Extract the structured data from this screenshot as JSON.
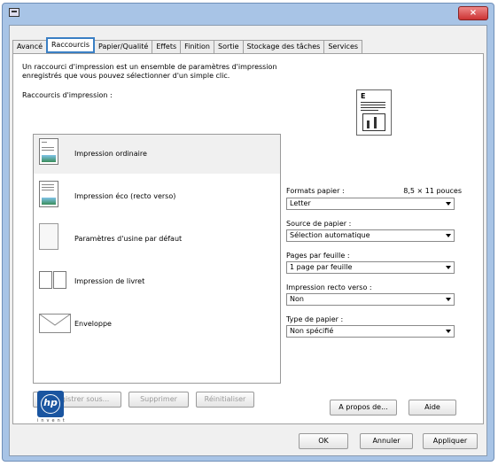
{
  "tabs": [
    "Avancé",
    "Raccourcis",
    "Papier/Qualité",
    "Effets",
    "Finition",
    "Sortie",
    "Stockage des tâches",
    "Services"
  ],
  "active_tab": "Raccourcis",
  "intro_text": "Un raccourci d'impression est un ensemble de paramètres d'impression enregistrés que vous pouvez sélectionner d'un simple clic.",
  "shortcuts_label": "Raccourcis d'impression :",
  "shortcuts": [
    {
      "label": "Impression ordinaire",
      "icon": "document-icon",
      "selected": true
    },
    {
      "label": "Impression éco (recto verso)",
      "icon": "duplex-document-icon",
      "selected": false
    },
    {
      "label": "Paramètres d'usine par défaut",
      "icon": "blank-page-icon",
      "selected": false
    },
    {
      "label": "Impression de livret",
      "icon": "booklet-icon",
      "selected": false
    },
    {
      "label": "Enveloppe",
      "icon": "envelope-icon",
      "selected": false
    }
  ],
  "list_buttons": {
    "save": "Enregistrer sous...",
    "delete": "Supprimer",
    "reset": "Réinitialiser"
  },
  "fields": {
    "paper_size_label": "Formats papier :",
    "paper_size_dims": "8,5 × 11 pouces",
    "paper_size_value": "Letter",
    "paper_source_label": "Source de papier :",
    "paper_source_value": "Sélection automatique",
    "pages_per_sheet_label": "Pages par feuille :",
    "pages_per_sheet_value": "1 page par feuille",
    "duplex_label": "Impression recto verso :",
    "duplex_value": "Non",
    "paper_type_label": "Type de papier :",
    "paper_type_value": "Non spécifié"
  },
  "panel_buttons": {
    "about": "A propos de...",
    "help": "Aide"
  },
  "dialog_buttons": {
    "ok": "OK",
    "cancel": "Annuler",
    "apply": "Appliquer"
  },
  "logo": {
    "text": "hp",
    "tagline": "invent"
  },
  "colors": {
    "tab_highlight": "#3a7fc4",
    "window_frame": "#a8c4e6",
    "close_button": "#c33"
  }
}
